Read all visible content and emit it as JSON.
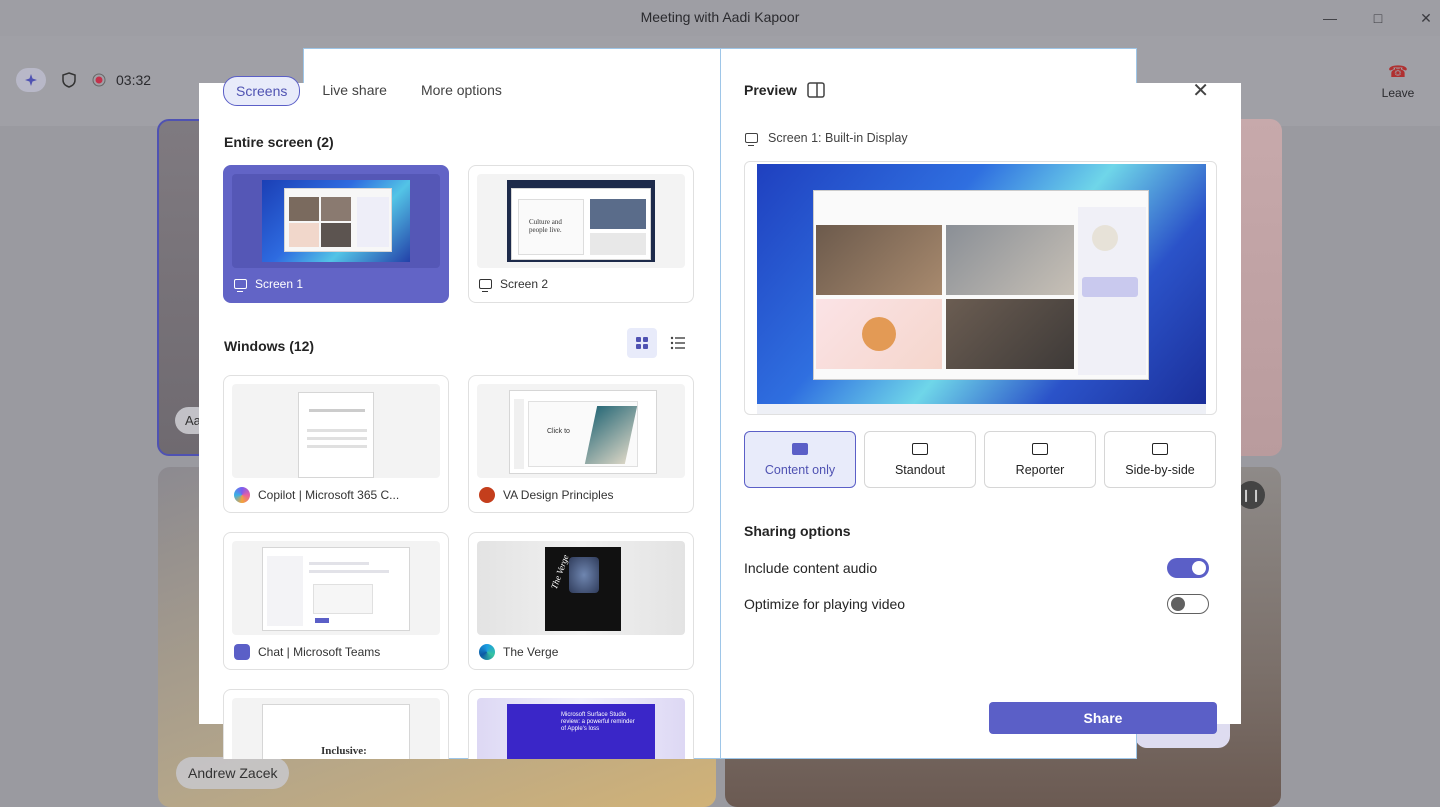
{
  "window": {
    "title": "Meeting with Aadi Kapoor"
  },
  "meeting": {
    "timer": "03:32",
    "leave_label": "Leave",
    "participants": [
      "Aa",
      "Andrew Zacek"
    ]
  },
  "dialog": {
    "tabs": [
      {
        "label": "Screens",
        "active": true
      },
      {
        "label": "Live share",
        "active": false
      },
      {
        "label": "More options",
        "active": false
      }
    ],
    "entire_screen": {
      "title": "Entire screen (2)",
      "items": [
        {
          "label": "Screen 1",
          "selected": true
        },
        {
          "label": "Screen 2",
          "selected": false
        }
      ]
    },
    "windows": {
      "title": "Windows (12)",
      "items": [
        {
          "label": "Copilot | Microsoft 365 C...",
          "icon": "copilot-icon"
        },
        {
          "label": "VA Design Principles",
          "icon": "powerpoint-icon"
        },
        {
          "label": "Chat | Microsoft Teams",
          "icon": "teams-icon"
        },
        {
          "label": "The Verge",
          "icon": "edge-icon"
        }
      ],
      "thumb_text": {
        "screen2": "Culture and people live.",
        "inclusive": "Inclusive:",
        "click_to": "Click to",
        "surface": "Microsoft Surface Studio review: a powerful reminder of Apple's loss",
        "verge": "The Verge"
      }
    },
    "preview": {
      "title": "Preview",
      "screen_label": "Screen 1: Built-in Display",
      "layouts": [
        {
          "label": "Content only",
          "active": true
        },
        {
          "label": "Standout",
          "active": false
        },
        {
          "label": "Reporter",
          "active": false
        },
        {
          "label": "Side-by-side",
          "active": false
        }
      ]
    },
    "sharing_options": {
      "title": "Sharing options",
      "include_audio": {
        "label": "Include content audio",
        "on": true
      },
      "optimize_video": {
        "label": "Optimize for playing video",
        "on": false
      }
    },
    "share_label": "Share"
  },
  "colors": {
    "accent": "#5b5fc7",
    "selected_card": "#6264c6",
    "accent_light": "#e8ebfa"
  }
}
